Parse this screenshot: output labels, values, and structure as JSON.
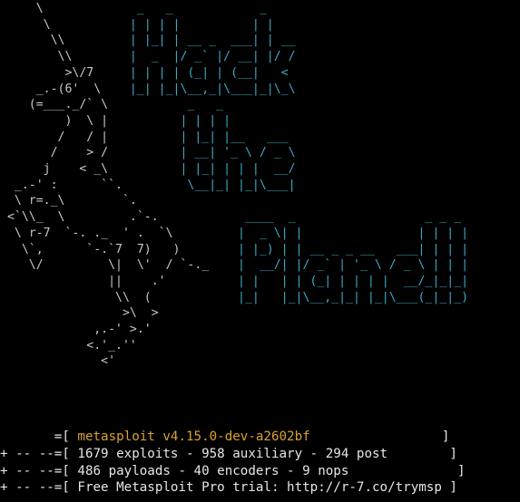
{
  "colors": {
    "background": "#000000",
    "ascii_art": "#c7c7c7",
    "banner": "#3fa8c4",
    "text": "#e6e6e6",
    "version": "#d7a230"
  },
  "ascii_unicorn": "     \\\n      \\\n       \\\\\n        \\\\\n         >\\/7\n     _.-(6'  \\\n    (=___._/` \\\n         )  \\ |\n        /   / |\n       /    > /\n      j    < _\\\n  _.-' :      ``.\n  \\ r=._\\        `.\n <`\\\\_  \\         .`-.\n  \\ r-7  `-. ._  ' .  `\\\n   \\`,      `-.`7  7)   )\n    \\/         \\|  \\'  / `-._\n               ||    .'\n                \\\\  (\n                 >\\  >\n             ,.-' >.'\n            <.'_.''\n              <'",
  "ascii_banner": "                   _   _            _\n                  | | | |          | |\n                  | |_| | __ _  ___| | __\n                  |  _  |/ _` |/ __| |/ /\n                  | | | | (_| | (__|   <\n                  |_| |_|\\__,_|\\___|_|\\_\\\n                          _   _\n                         | | | |\n                         | |_| |__   ___\n                         | __| '_ \\ / _ \\\n                         | |_| | | |  __/\n                          \\__|_| |_|\\___|\n\n                                  ____  _                  _ _ _\n                                 |  _ \\| |                | | | |\n                                 | |_) | | __ _ _ __   ___| | | |\n                                 |  __/| |/ _` | '_ \\ / _ \\ | | |\n                                 | |   | | (_| | | | |  __/_|_|_|\n                                 |_|   |_|\\__,_|_| |_|\\___(_|_|_)",
  "info": {
    "line1": {
      "prefix": "       =[ ",
      "version": "metasploit v4.15.0-dev-a2602bf",
      "suffix": "                 ]"
    },
    "line2": "+ -- --=[ 1679 exploits - 958 auxiliary - 294 post        ]",
    "line3": "+ -- --=[ 486 payloads - 40 encoders - 9 nops              ]",
    "line4": "+ -- --=[ Free Metasploit Pro trial: http://r-7.co/trymsp ]"
  }
}
